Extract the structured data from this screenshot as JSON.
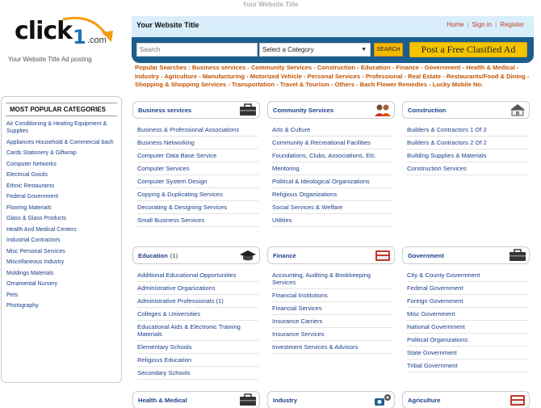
{
  "page_top_title": "Your Website Title",
  "logo": {
    "word": "click",
    "number": "1",
    "suffix": ".com"
  },
  "tagline": "Your Website Title Ad posting",
  "header": {
    "site_title": "Your Website Title",
    "links": [
      "Home",
      "Sign in",
      "Register"
    ]
  },
  "search": {
    "placeholder": "Search",
    "category_selected": "Select a Category",
    "search_button": "SEARCH",
    "post_button": "Post a Free Clasified Ad"
  },
  "popular_searches": {
    "label": "Popular Searches : ",
    "items": [
      "Business services",
      "Community Services",
      "Construction",
      "Education",
      "Finance",
      "Government",
      "Health & Medical",
      "Industry",
      "Agriculture",
      "Manufacturing",
      "Motorized Vehicle",
      "Personal Services",
      "Professional",
      "Real Estate",
      "Restaurants/Food & Dining",
      "Shopping & Shopping Services",
      "Transportation",
      "Travel & Tourism",
      "Others",
      "Bach Flower Remedies",
      "Lucky Mobile No."
    ]
  },
  "sidebar": {
    "heading": "MOST POPULAR CATEGORIES",
    "items": [
      "Air Conditioning & Heating Equipment & Supplies",
      "Appliances Household & Commercial bach",
      "Cards Stationery & Giftwrap",
      "Computer Networks",
      "Electrical Goods",
      "Ethnic Restaurants",
      "Federal Government",
      "Flooring Materials",
      "Glass & Glass Products",
      "Health And Medical Centers",
      "Industrial Contractors",
      "Misc Personal Services",
      "Miscellaneous Industry",
      "Moldings Materials",
      "Ornamental Nursery",
      "Pets",
      "Photography"
    ]
  },
  "categories": [
    {
      "title": "Business services",
      "count": "",
      "icon": "briefcase-icon",
      "items": [
        "Business & Professional Associations",
        "Business Networking",
        "Computer Data Base Service",
        "Computer Services",
        "Computer System Design",
        "Copying & Duplicating Services",
        "Decorating & Designing Services",
        "Small Business Services"
      ]
    },
    {
      "title": "Community Services",
      "count": "",
      "icon": "people-icon",
      "items": [
        "Arts & Culture",
        "Community & Recreational Facilities",
        "Foundations, Clubs, Associations, Etc.",
        "Mentoring",
        "Political & Ideological Organizations",
        "Religious Organizations",
        "Social Services & Welfare",
        "Utilities"
      ]
    },
    {
      "title": "Construction",
      "count": "",
      "icon": "house-icon",
      "items": [
        "Builders & Contractors 1 Of 2",
        "Builders & Contractors 2 Of 2",
        "Building Supplies & Materials",
        "Construction Services"
      ]
    },
    {
      "title": "Education",
      "count": "(1)",
      "icon": "graduation-cap-icon",
      "items": [
        "Additional Educational Opportunities",
        "Administrative Organizations",
        "Administrative Professionals (1)",
        "Colleges & Universities",
        "Educational Aids & Electronic Training Materials",
        "Elementary Schools",
        "Religious Education",
        "Secondary Schools"
      ]
    },
    {
      "title": "Finance",
      "count": "",
      "icon": "calculator-icon",
      "items": [
        "Accounting, Auditing & Bookkeeping Services",
        "Financial Institutions",
        "Financial Services",
        "Insurance Carriers",
        "Insurance Services",
        "Investment Services & Advisors"
      ]
    },
    {
      "title": "Government",
      "count": "",
      "icon": "briefcase-icon",
      "items": [
        "City & County Government",
        "Federal Government",
        "Foreign Government",
        "Misc Government",
        "National Government",
        "Political Organizations",
        "State Government",
        "Tribal Government"
      ]
    },
    {
      "title": "Health & Medical",
      "count": "",
      "icon": "briefcase-icon",
      "items": []
    },
    {
      "title": "Industry",
      "count": "",
      "icon": "gears-icon",
      "items": []
    },
    {
      "title": "Agriculture",
      "count": "",
      "icon": "calculator-icon",
      "items": []
    }
  ],
  "colors": {
    "header_bg": "#d9eefb",
    "search_bar": "#1b5e8e",
    "accent_yellow": "#f5c400",
    "link_blue": "#1a3e8a",
    "popular_orange": "#c25400",
    "header_link_red": "#c0392b"
  }
}
